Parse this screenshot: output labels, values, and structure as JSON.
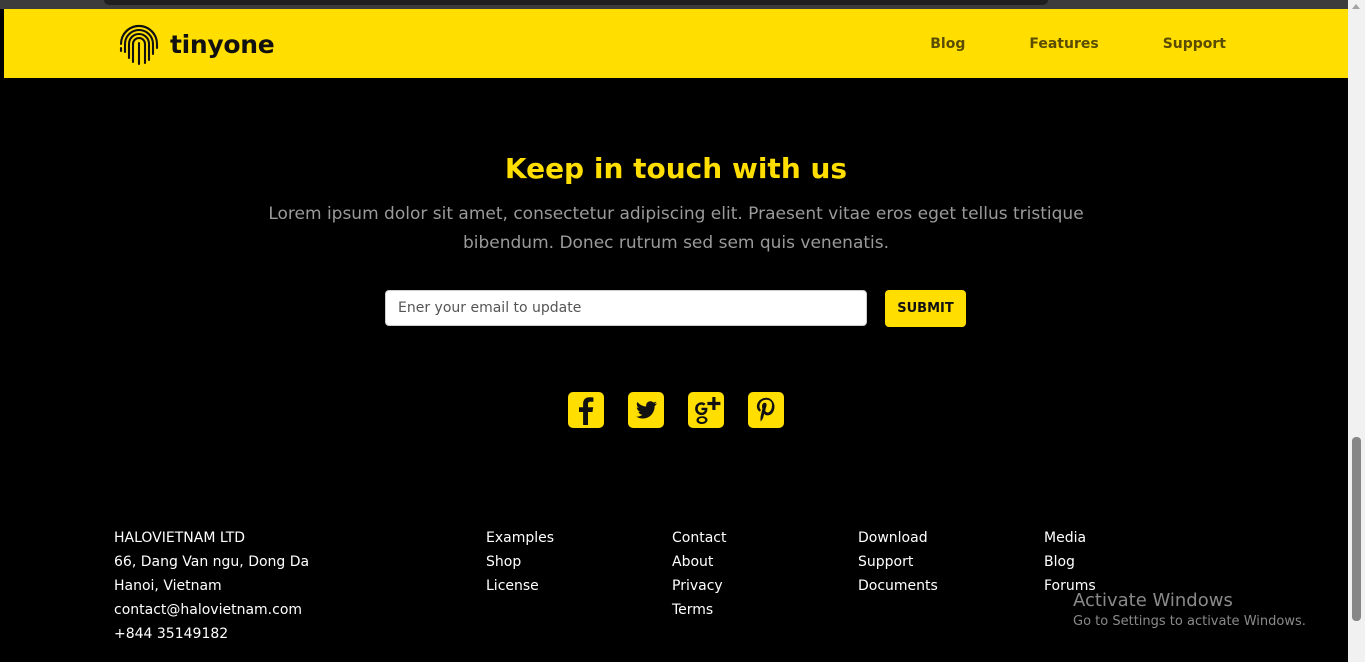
{
  "header": {
    "brand": "tinyone",
    "nav": [
      "Blog",
      "Features",
      "Support"
    ]
  },
  "main": {
    "title": "Keep in touch with us",
    "description": "Lorem ipsum dolor sit amet, consectetur adipiscing elit. Praesent vitae eros eget tellus tristique bibendum. Donec rutrum sed sem quis venenatis.",
    "email_placeholder": "Ener your email to update",
    "submit_label": "SUBMIT",
    "socials": [
      "facebook-icon",
      "twitter-icon",
      "google-plus-icon",
      "pinterest-icon"
    ]
  },
  "footer": {
    "address": [
      "HALOVIETNAM LTD",
      "66, Dang Van ngu, Dong Da",
      "Hanoi, Vietnam",
      "contact@halovietnam.com",
      "+844 35149182"
    ],
    "col1": [
      "Examples",
      "Shop",
      "License"
    ],
    "col2": [
      "Contact",
      "About",
      "Privacy",
      "Terms"
    ],
    "col3": [
      "Download",
      "Support",
      "Documents"
    ],
    "col4": [
      "Media",
      "Blog",
      "Forums"
    ]
  },
  "watermark": {
    "title": "Activate Windows",
    "subtitle": "Go to Settings to activate Windows."
  },
  "colors": {
    "accent": "#ffde00",
    "background": "#000000",
    "description": "#9a9a9a"
  }
}
